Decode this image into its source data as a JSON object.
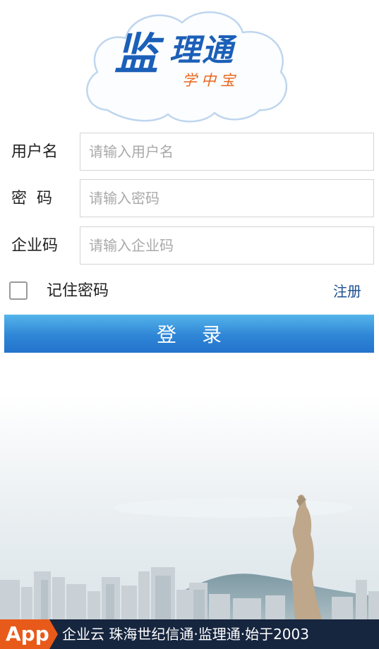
{
  "logo": {
    "main": "监",
    "tail": "理通",
    "sub": "学中宝"
  },
  "form": {
    "username": {
      "label": "用户名",
      "placeholder": "请输入用户名",
      "value": ""
    },
    "password": {
      "label": "密  码",
      "placeholder": "请输入密码",
      "value": ""
    },
    "company_code": {
      "label": "企业码",
      "placeholder": "请输入企业码",
      "value": ""
    }
  },
  "remember": {
    "label": "记住密码",
    "checked": false
  },
  "register": {
    "label": "注册"
  },
  "login_button": {
    "label": "登录"
  },
  "footer": {
    "app_badge": "App",
    "slogan": "企业云 珠海世纪信通·监理通·始于2003"
  },
  "colors": {
    "accent_blue": "#2f86d6",
    "logo_blue": "#1b5fb8",
    "logo_orange": "#e8671e",
    "link_blue": "#1c4f8f",
    "footer_bg": "#17263f",
    "badge_orange": "#e85a1a"
  },
  "icons": {
    "logo": "cloud-logo-icon",
    "checkbox": "checkbox-icon",
    "background": "city-skyline-icon"
  }
}
